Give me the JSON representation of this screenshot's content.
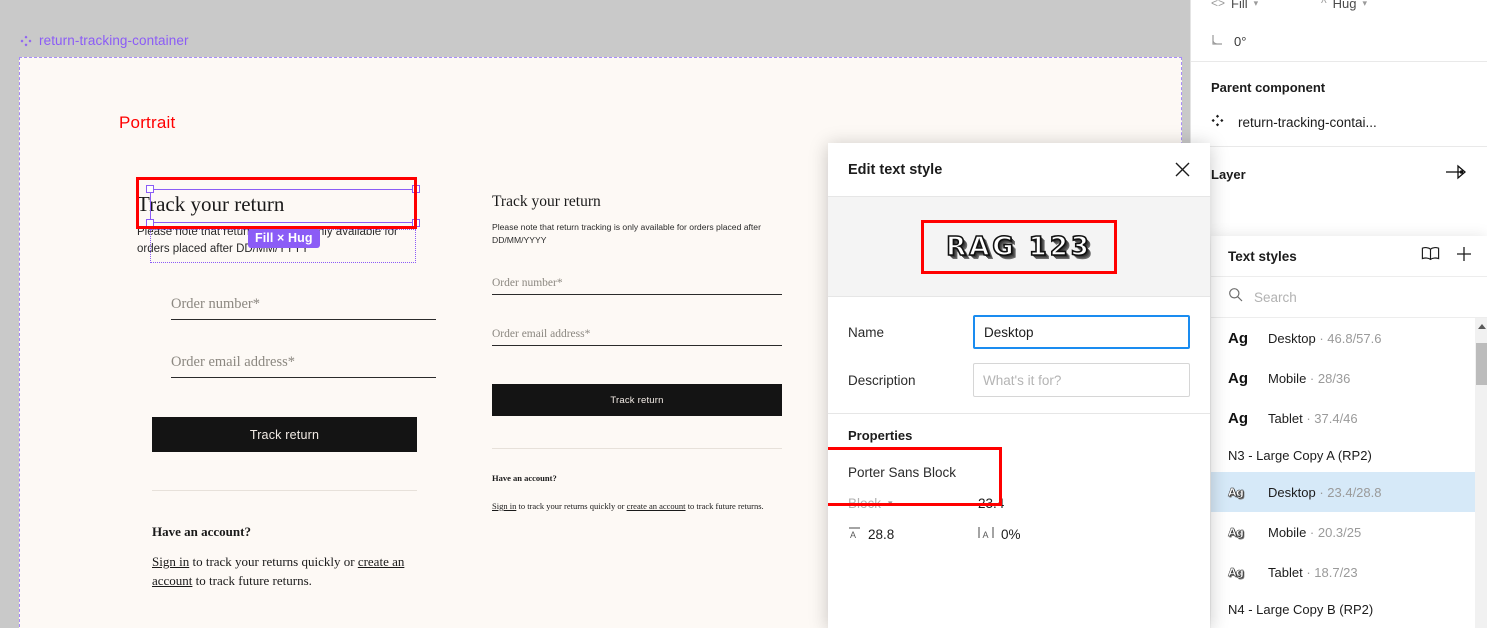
{
  "canvas": {
    "frame_label": "return-tracking-container",
    "portrait_label": "Portrait",
    "badge": "Fill × Hug",
    "columnA": {
      "heading": "Track your return",
      "note": "Please note that return tracking is only available for orders placed after DD/MM/YYYY",
      "order_number_label": "Order number*",
      "order_email_label": "Order email address*",
      "button": "Track return",
      "have_account": "Have an account?",
      "signin_link": "Sign in",
      "signin_mid": " to track your returns quickly or ",
      "create_link": "create an account",
      "signin_tail": " to track future returns."
    },
    "columnB": {
      "heading": "Track your return",
      "note": "Please note that return tracking is only available for orders placed after DD/MM/YYYY",
      "order_number_label": "Order number*",
      "order_email_label": "Order email address*",
      "button": "Track return",
      "have_account": "Have an account?",
      "signin_link": "Sign in",
      "signin_mid": " to track your returns quickly or ",
      "create_link": "create an account",
      "signin_tail": " to track future returns."
    }
  },
  "modal": {
    "title": "Edit text style",
    "close_icon": "close-icon",
    "preview_text": "RAG 123",
    "name_label": "Name",
    "name_value": "Desktop",
    "description_label": "Description",
    "description_placeholder": "What's it for?",
    "properties_title": "Properties",
    "font_family": "Porter Sans Block",
    "font_weight": "Block",
    "font_size": "23.4",
    "line_height": "28.8",
    "letter_spacing": "0%"
  },
  "right_panel": {
    "width_mode": "Fill",
    "height_mode": "Hug",
    "rotation": "0°",
    "parent_component_title": "Parent component",
    "parent_component_name": "return-tracking-contai...",
    "layer_title": "Layer"
  },
  "text_styles": {
    "title": "Text styles",
    "book_icon": "book-icon",
    "add_icon": "plus-icon",
    "search_placeholder": "Search",
    "search_value": "",
    "items": [
      {
        "type": "style",
        "preview": "Ag",
        "big": true,
        "name": "Desktop",
        "size": "46.8/57.6",
        "selected": false
      },
      {
        "type": "style",
        "preview": "Ag",
        "big": true,
        "name": "Mobile",
        "size": "28/36",
        "selected": false
      },
      {
        "type": "style",
        "preview": "Ag",
        "big": true,
        "name": "Tablet",
        "size": "37.4/46",
        "selected": false
      },
      {
        "type": "group",
        "label": "N3 - Large Copy A (RP2)"
      },
      {
        "type": "style",
        "preview": "Ag",
        "big": false,
        "name": "Desktop",
        "size": "23.4/28.8",
        "selected": true
      },
      {
        "type": "style",
        "preview": "Ag",
        "big": false,
        "name": "Mobile",
        "size": "20.3/25",
        "selected": false
      },
      {
        "type": "style",
        "preview": "Ag",
        "big": false,
        "name": "Tablet",
        "size": "18.7/23",
        "selected": false
      },
      {
        "type": "group",
        "label": "N4 - Large Copy B (RP2)"
      }
    ]
  },
  "colors": {
    "selection_purple": "#8b5cf6",
    "annotation_red": "#ff0000",
    "canvas_gray": "#c9c9c9",
    "frame_cream": "#fdf9f5",
    "focus_blue": "#1a8cf0",
    "row_selected_blue": "#d6e9f8",
    "button_black": "#141414"
  }
}
